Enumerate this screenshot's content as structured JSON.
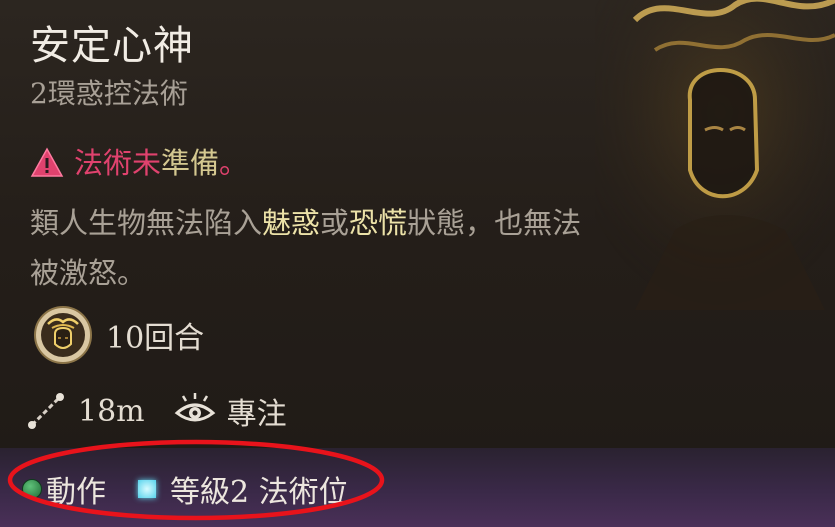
{
  "spell": {
    "name": "安定心神",
    "subtitle": "2環惑控法術",
    "warning": {
      "icon": "warning-triangle-icon",
      "text_red": "法術未",
      "text_gold": "準備",
      "text_end": "。"
    },
    "description": {
      "part1": "類人生物無法陷入",
      "hl1": "魅惑",
      "part2": "或",
      "hl2": "恐慌",
      "part3": "狀態，也無法被激怒。"
    },
    "duration": {
      "icon": "calm-face-icon",
      "text": "10回合"
    },
    "range": {
      "icon": "range-line-icon",
      "text": "18m"
    },
    "concentration": {
      "icon": "eye-icon",
      "text": "專注"
    },
    "cost": {
      "action_icon": "action-dot-icon",
      "action_label": "動作",
      "slot_icon": "spell-slot-icon",
      "slot_label": "等級2 法術位"
    }
  },
  "colors": {
    "warning_red": "#e0426e",
    "highlight_gold": "#ece2a8",
    "action_green": "#3fa35a",
    "slot_cyan": "#5fd8f0",
    "annotation_red": "#e8131b"
  }
}
